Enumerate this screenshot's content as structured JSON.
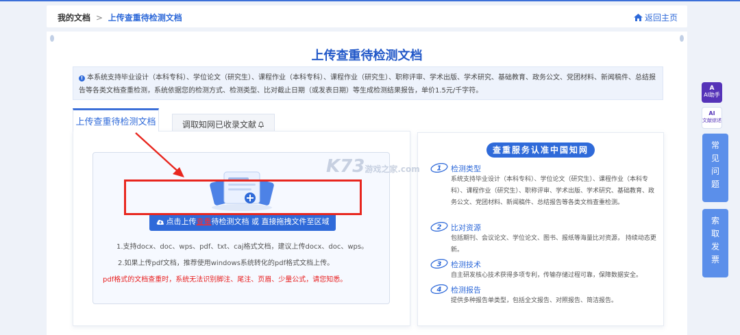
{
  "breadcrumb": {
    "home": "我的文档",
    "separator": ">",
    "current": "上传查重待检测文档"
  },
  "back_home": "返回主页",
  "page_title": "上传查重待检测文档",
  "notice": "本系统支持毕业设计（本科专科）、学位论文（研究生）、课程作业（本科专科）、课程作业（研究生）、职称评审、学术出版、学术研究、基础教育、政务公文、党团材料、新闻稿件、总结报告等各类文档查重检测，系统依据您的检测方式、检测类型、比对截止日期（或发表日期）等生成检测结果报告，单价1.5元/千字符。",
  "tabs": [
    {
      "label": "上传查重待检测文档",
      "active": true
    },
    {
      "label": "调取知网已收录文献",
      "active": false
    }
  ],
  "upload": {
    "button_prefix": "点击上传",
    "button_highlight": "查重",
    "button_suffix": "待检测文档 或 直接拖拽文件至区域",
    "hint1": "1.支持docx、doc、wps、pdf、txt、caj格式文档，建议上传docx、doc、wps。",
    "hint2": "2.如果上传pdf文档，推荐使用windows系统转化的pdf格式文档上传。",
    "warning": "pdf格式的文档查重时，系统无法识别脚注、尾注、页眉、少量公式，请您知悉。"
  },
  "service": {
    "badge": "查重服务认准中国知网",
    "features": [
      {
        "num": "1",
        "title": "检测类型",
        "desc": "系统支持毕业设计（本科专科）、学位论文（研究生）、课程作业（本科专科）、课程作业（研究生）、职称评审、学术出版、学术研究、基础教育、政务公文、党团材料、新闻稿件、总结报告等各类文档查重检测。"
      },
      {
        "num": "2",
        "title": "比对资源",
        "desc": "包括期刊、会议论文、学位论文、图书、报纸等海量比对资源， 持续动态更新。"
      },
      {
        "num": "3",
        "title": "检测技术",
        "desc": "自主研发核心技术获得多项专利，传输存储过程可靠，保障数据安全。"
      },
      {
        "num": "4",
        "title": "检测报告",
        "desc": "提供多种报告单类型，包括全文报告、对照报告、简洁报告。"
      }
    ]
  },
  "watermark": {
    "main": "K73",
    "sub": "游戏之家",
    "domain": ".com"
  },
  "sidebar": {
    "ai_label": "AI助手",
    "wenxian_label": "文献综述",
    "faq": [
      "常",
      "见",
      "问",
      "题"
    ],
    "invoice": [
      "索",
      "取",
      "发",
      "票"
    ]
  },
  "colors": {
    "primary": "#2f6ad9",
    "warning": "#e82020",
    "annotation": "#e8261e",
    "ai": "#5533b8",
    "side": "#5b8fea"
  }
}
